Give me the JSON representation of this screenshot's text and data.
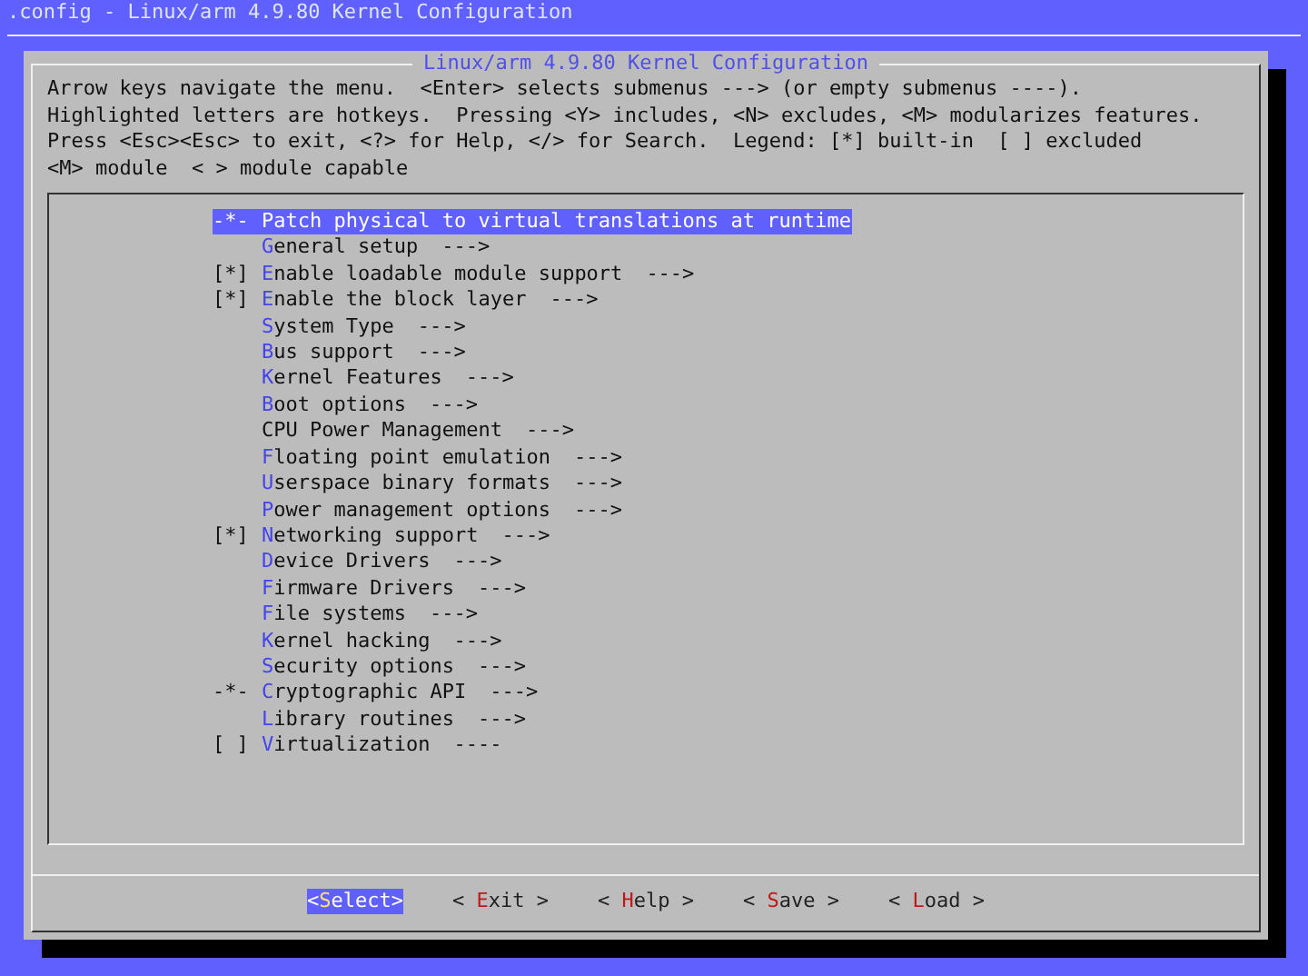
{
  "window": {
    "title": ".config - Linux/arm 4.9.80 Kernel Configuration"
  },
  "dialog": {
    "title": "Linux/arm 4.9.80 Kernel Configuration",
    "help": [
      "Arrow keys navigate the menu.  <Enter> selects submenus ---> (or empty submenus ----).",
      "Highlighted letters are hotkeys.  Pressing <Y> includes, <N> excludes, <M> modularizes features.",
      "Press <Esc><Esc> to exit, <?> for Help, </> for Search.  Legend: [*] built-in  [ ] excluded",
      "<M> module  < > module capable"
    ]
  },
  "menu": [
    {
      "prefix": "-*-",
      "key": "P",
      "rest": "atch physical to virtual translations at runtime",
      "selected": true
    },
    {
      "key": "G",
      "rest": "eneral setup",
      "suffix": "--->",
      "selected": false
    },
    {
      "prefix": "[*]",
      "key": "E",
      "rest": "nable loadable module support",
      "suffix": "--->",
      "selected": false
    },
    {
      "prefix": "[*]",
      "key": "E",
      "rest": "nable the block layer",
      "suffix": "--->",
      "selected": false
    },
    {
      "key": "S",
      "rest": "ystem Type",
      "suffix": "--->",
      "selected": false
    },
    {
      "key": "B",
      "rest": "us support",
      "suffix": "--->",
      "selected": false
    },
    {
      "key": "K",
      "rest": "ernel Features",
      "suffix": "--->",
      "selected": false
    },
    {
      "key": "B",
      "rest": "oot options",
      "suffix": "--->",
      "selected": false
    },
    {
      "rest": "CPU Power Management",
      "suffix": "--->",
      "selected": false
    },
    {
      "key": "F",
      "rest": "loating point emulation",
      "suffix": "--->",
      "selected": false
    },
    {
      "key": "U",
      "rest": "serspace binary formats",
      "suffix": "--->",
      "selected": false
    },
    {
      "key": "P",
      "rest": "ower management options",
      "suffix": "--->",
      "selected": false
    },
    {
      "prefix": "[*]",
      "key": "N",
      "rest": "etworking support",
      "suffix": "--->",
      "selected": false
    },
    {
      "key": "D",
      "rest": "evice Drivers",
      "suffix": "--->",
      "selected": false
    },
    {
      "key": "F",
      "rest": "irmware Drivers",
      "suffix": "--->",
      "selected": false
    },
    {
      "key": "F",
      "rest": "ile systems",
      "suffix": "--->",
      "selected": false
    },
    {
      "key": "K",
      "rest": "ernel hacking",
      "suffix": "--->",
      "selected": false
    },
    {
      "key": "S",
      "rest": "ecurity options",
      "suffix": "--->",
      "selected": false
    },
    {
      "prefix": "-*-",
      "key": "C",
      "rest": "ryptographic API",
      "suffix": "--->",
      "selected": false
    },
    {
      "key": "L",
      "rest": "ibrary routines",
      "suffix": "--->",
      "selected": false
    },
    {
      "prefix": "[ ]",
      "key": "V",
      "rest": "irtualization",
      "suffix": "----",
      "selected": false
    }
  ],
  "buttons": [
    {
      "open": "<",
      "key": "S",
      "rest": "elect",
      "close": ">",
      "selected": true
    },
    {
      "open": "< ",
      "key": "E",
      "rest": "xit",
      "close": " >",
      "selected": false
    },
    {
      "open": "< ",
      "key": "H",
      "rest": "elp",
      "close": " >",
      "selected": false
    },
    {
      "open": "< ",
      "key": "S",
      "rest": "ave",
      "close": " >",
      "selected": false
    },
    {
      "open": "< ",
      "key": "L",
      "rest": "oad",
      "close": " >",
      "selected": false
    }
  ]
}
